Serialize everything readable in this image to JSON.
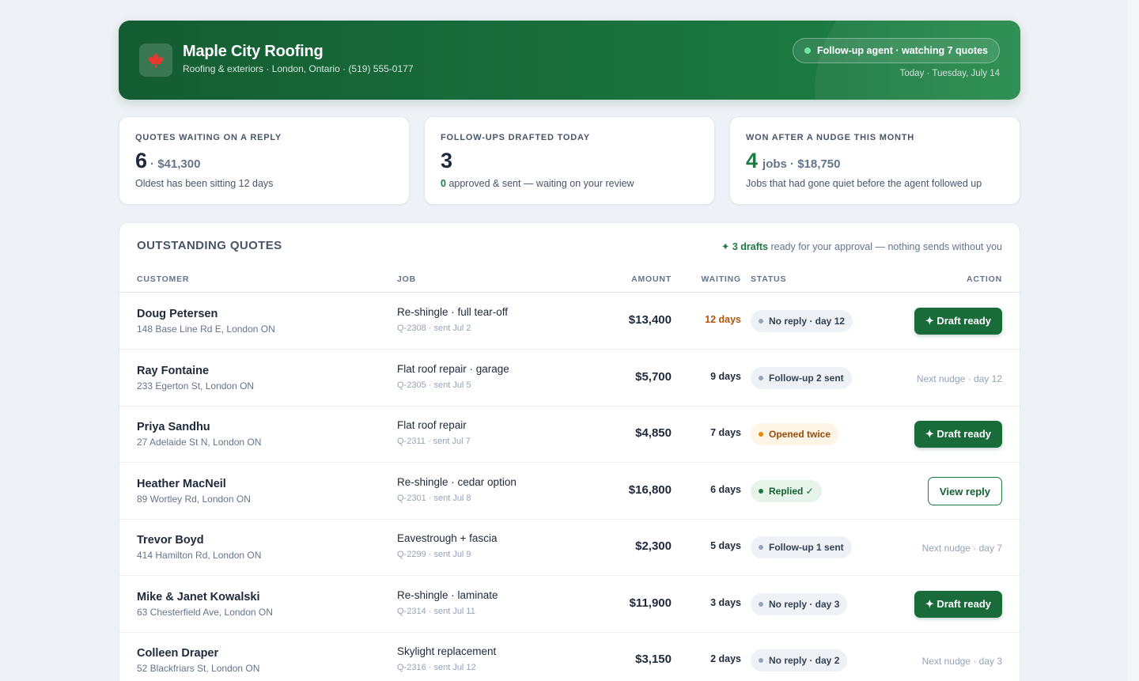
{
  "header": {
    "business_name": "Maple City Roofing",
    "business_sub": "Roofing & exteriors · London, Ontario · (519) 555-0177",
    "logo_icon": "maple-leaf-icon",
    "agent_status": "Follow-up agent · watching 7 quotes",
    "today": "Today · Tuesday, July 14"
  },
  "stats": [
    {
      "label": "QUOTES WAITING ON A REPLY",
      "value": "6",
      "extra": "· $41,300",
      "note_strong": "",
      "note": "Oldest has been sitting 12 days"
    },
    {
      "label": "FOLLOW-UPS DRAFTED TODAY",
      "value": "3",
      "extra": "",
      "note_strong": "0",
      "note": "approved & sent — waiting on your review"
    },
    {
      "label": "WON AFTER A NUDGE THIS MONTH",
      "value": "4",
      "extra": "jobs · $18,750",
      "note_strong": "",
      "note": "Jobs that had gone quiet before the agent followed up"
    }
  ],
  "quotes": {
    "title": "OUTSTANDING QUOTES",
    "hint_accent": "✦ 3 drafts",
    "hint_rest": "ready for your approval — nothing sends without you",
    "columns": {
      "customer": "CUSTOMER",
      "job": "JOB",
      "amount": "AMOUNT",
      "waiting": "WAITING",
      "status": "STATUS",
      "action": "ACTION"
    },
    "rows": [
      {
        "name": "Doug Petersen",
        "address": "148 Base Line Rd E, London ON",
        "job": "Re-shingle · full tear-off",
        "ref": "Q-2308 · sent Jul 2",
        "amount": "$13,400",
        "waiting": "12 days",
        "status": "No reply · day 12",
        "action": "✦ Draft ready"
      },
      {
        "name": "Ray Fontaine",
        "address": "233 Egerton St, London ON",
        "job": "Flat roof repair · garage",
        "ref": "Q-2305 · sent Jul 5",
        "amount": "$5,700",
        "waiting": "9 days",
        "status": "Follow-up 2 sent",
        "action": "Next nudge · day 12"
      },
      {
        "name": "Priya Sandhu",
        "address": "27 Adelaide St N, London ON",
        "job": "Flat roof repair",
        "ref": "Q-2311 · sent Jul 7",
        "amount": "$4,850",
        "waiting": "7 days",
        "status": "Opened twice",
        "action": "✦ Draft ready"
      },
      {
        "name": "Heather MacNeil",
        "address": "89 Wortley Rd, London ON",
        "job": "Re-shingle · cedar option",
        "ref": "Q-2301 · sent Jul 8",
        "amount": "$16,800",
        "waiting": "6 days",
        "status": "Replied ✓",
        "action": "View reply"
      },
      {
        "name": "Trevor Boyd",
        "address": "414 Hamilton Rd, London ON",
        "job": "Eavestrough + fascia",
        "ref": "Q-2299 · sent Jul 9",
        "amount": "$2,300",
        "waiting": "5 days",
        "status": "Follow-up 1 sent",
        "action": "Next nudge · day 7"
      },
      {
        "name": "Mike & Janet Kowalski",
        "address": "63 Chesterfield Ave, London ON",
        "job": "Re-shingle · laminate",
        "ref": "Q-2314 · sent Jul 11",
        "amount": "$11,900",
        "waiting": "3 days",
        "status": "No reply · day 3",
        "action": "✦ Draft ready"
      },
      {
        "name": "Colleen Draper",
        "address": "52 Blackfriars St, London ON",
        "job": "Skylight replacement",
        "ref": "Q-2316 · sent Jul 12",
        "amount": "$3,150",
        "waiting": "2 days",
        "status": "No reply · day 2",
        "action": "Next nudge · day 3"
      }
    ]
  },
  "colors": {
    "brand_green": "#1c7a42",
    "warning_text": "#b45309",
    "status_gray_dot": "#94a3b8",
    "status_amber_dot": "#e58a0b",
    "status_green_dot": "#1c7a42"
  }
}
